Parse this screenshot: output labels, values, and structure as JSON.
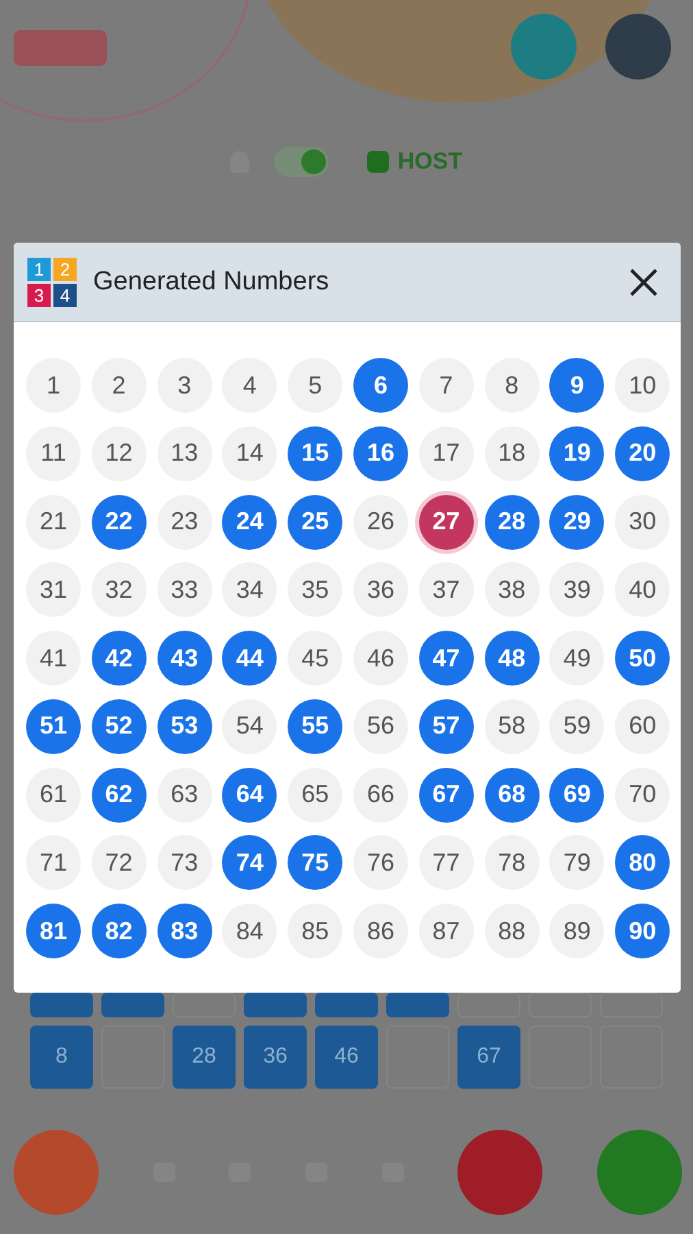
{
  "background": {
    "toggle": {
      "on": true
    },
    "roles": [
      {
        "label": "HOST",
        "selected": true
      }
    ],
    "ticket": {
      "rows": [
        {
          "cells": [
            {
              "filled": true
            },
            {
              "filled": true
            },
            {
              "filled": false
            },
            {
              "filled": true
            },
            {
              "filled": true
            },
            {
              "filled": true
            },
            {
              "filled": false
            },
            {
              "filled": false
            },
            {
              "filled": false
            }
          ]
        },
        {
          "cells": [
            {
              "filled": true,
              "number": "8"
            },
            {
              "filled": false
            },
            {
              "filled": true,
              "number": "28"
            },
            {
              "filled": true,
              "number": "36"
            },
            {
              "filled": true,
              "number": "46"
            },
            {
              "filled": false
            },
            {
              "filled": true,
              "number": "67"
            },
            {
              "filled": false
            },
            {
              "filled": false
            }
          ]
        }
      ]
    }
  },
  "dialog": {
    "title": "Generated Numbers",
    "logo": [
      {
        "digit": "1",
        "color": "#1e9ad6"
      },
      {
        "digit": "2",
        "color": "#f5a623"
      },
      {
        "digit": "3",
        "color": "#d81b4f"
      },
      {
        "digit": "4",
        "color": "#1d4f8a"
      }
    ],
    "numbers": [
      {
        "label": "1",
        "called": false,
        "current": false
      },
      {
        "label": "2",
        "called": false,
        "current": false
      },
      {
        "label": "3",
        "called": false,
        "current": false
      },
      {
        "label": "4",
        "called": false,
        "current": false
      },
      {
        "label": "5",
        "called": false,
        "current": false
      },
      {
        "label": "6",
        "called": true,
        "current": false
      },
      {
        "label": "7",
        "called": false,
        "current": false
      },
      {
        "label": "8",
        "called": false,
        "current": false
      },
      {
        "label": "9",
        "called": true,
        "current": false
      },
      {
        "label": "10",
        "called": false,
        "current": false
      },
      {
        "label": "11",
        "called": false,
        "current": false
      },
      {
        "label": "12",
        "called": false,
        "current": false
      },
      {
        "label": "13",
        "called": false,
        "current": false
      },
      {
        "label": "14",
        "called": false,
        "current": false
      },
      {
        "label": "15",
        "called": true,
        "current": false
      },
      {
        "label": "16",
        "called": true,
        "current": false
      },
      {
        "label": "17",
        "called": false,
        "current": false
      },
      {
        "label": "18",
        "called": false,
        "current": false
      },
      {
        "label": "19",
        "called": true,
        "current": false
      },
      {
        "label": "20",
        "called": true,
        "current": false
      },
      {
        "label": "21",
        "called": false,
        "current": false
      },
      {
        "label": "22",
        "called": true,
        "current": false
      },
      {
        "label": "23",
        "called": false,
        "current": false
      },
      {
        "label": "24",
        "called": true,
        "current": false
      },
      {
        "label": "25",
        "called": true,
        "current": false
      },
      {
        "label": "26",
        "called": false,
        "current": false
      },
      {
        "label": "27",
        "called": true,
        "current": true
      },
      {
        "label": "28",
        "called": true,
        "current": false
      },
      {
        "label": "29",
        "called": true,
        "current": false
      },
      {
        "label": "30",
        "called": false,
        "current": false
      },
      {
        "label": "31",
        "called": false,
        "current": false
      },
      {
        "label": "32",
        "called": false,
        "current": false
      },
      {
        "label": "33",
        "called": false,
        "current": false
      },
      {
        "label": "34",
        "called": false,
        "current": false
      },
      {
        "label": "35",
        "called": false,
        "current": false
      },
      {
        "label": "36",
        "called": false,
        "current": false
      },
      {
        "label": "37",
        "called": false,
        "current": false
      },
      {
        "label": "38",
        "called": false,
        "current": false
      },
      {
        "label": "39",
        "called": false,
        "current": false
      },
      {
        "label": "40",
        "called": false,
        "current": false
      },
      {
        "label": "41",
        "called": false,
        "current": false
      },
      {
        "label": "42",
        "called": true,
        "current": false
      },
      {
        "label": "43",
        "called": true,
        "current": false
      },
      {
        "label": "44",
        "called": true,
        "current": false
      },
      {
        "label": "45",
        "called": false,
        "current": false
      },
      {
        "label": "46",
        "called": false,
        "current": false
      },
      {
        "label": "47",
        "called": true,
        "current": false
      },
      {
        "label": "48",
        "called": true,
        "current": false
      },
      {
        "label": "49",
        "called": false,
        "current": false
      },
      {
        "label": "50",
        "called": true,
        "current": false
      },
      {
        "label": "51",
        "called": true,
        "current": false
      },
      {
        "label": "52",
        "called": true,
        "current": false
      },
      {
        "label": "53",
        "called": true,
        "current": false
      },
      {
        "label": "54",
        "called": false,
        "current": false
      },
      {
        "label": "55",
        "called": true,
        "current": false
      },
      {
        "label": "56",
        "called": false,
        "current": false
      },
      {
        "label": "57",
        "called": true,
        "current": false
      },
      {
        "label": "58",
        "called": false,
        "current": false
      },
      {
        "label": "59",
        "called": false,
        "current": false
      },
      {
        "label": "60",
        "called": false,
        "current": false
      },
      {
        "label": "61",
        "called": false,
        "current": false
      },
      {
        "label": "62",
        "called": true,
        "current": false
      },
      {
        "label": "63",
        "called": false,
        "current": false
      },
      {
        "label": "64",
        "called": true,
        "current": false
      },
      {
        "label": "65",
        "called": false,
        "current": false
      },
      {
        "label": "66",
        "called": false,
        "current": false
      },
      {
        "label": "67",
        "called": true,
        "current": false
      },
      {
        "label": "68",
        "called": true,
        "current": false
      },
      {
        "label": "69",
        "called": true,
        "current": false
      },
      {
        "label": "70",
        "called": false,
        "current": false
      },
      {
        "label": "71",
        "called": false,
        "current": false
      },
      {
        "label": "72",
        "called": false,
        "current": false
      },
      {
        "label": "73",
        "called": false,
        "current": false
      },
      {
        "label": "74",
        "called": true,
        "current": false
      },
      {
        "label": "75",
        "called": true,
        "current": false
      },
      {
        "label": "76",
        "called": false,
        "current": false
      },
      {
        "label": "77",
        "called": false,
        "current": false
      },
      {
        "label": "78",
        "called": false,
        "current": false
      },
      {
        "label": "79",
        "called": false,
        "current": false
      },
      {
        "label": "80",
        "called": true,
        "current": false
      },
      {
        "label": "81",
        "called": true,
        "current": false
      },
      {
        "label": "82",
        "called": true,
        "current": false
      },
      {
        "label": "83",
        "called": true,
        "current": false
      },
      {
        "label": "84",
        "called": false,
        "current": false
      },
      {
        "label": "85",
        "called": false,
        "current": false
      },
      {
        "label": "86",
        "called": false,
        "current": false
      },
      {
        "label": "87",
        "called": false,
        "current": false
      },
      {
        "label": "88",
        "called": false,
        "current": false
      },
      {
        "label": "89",
        "called": false,
        "current": false
      },
      {
        "label": "90",
        "called": true,
        "current": false
      }
    ]
  }
}
